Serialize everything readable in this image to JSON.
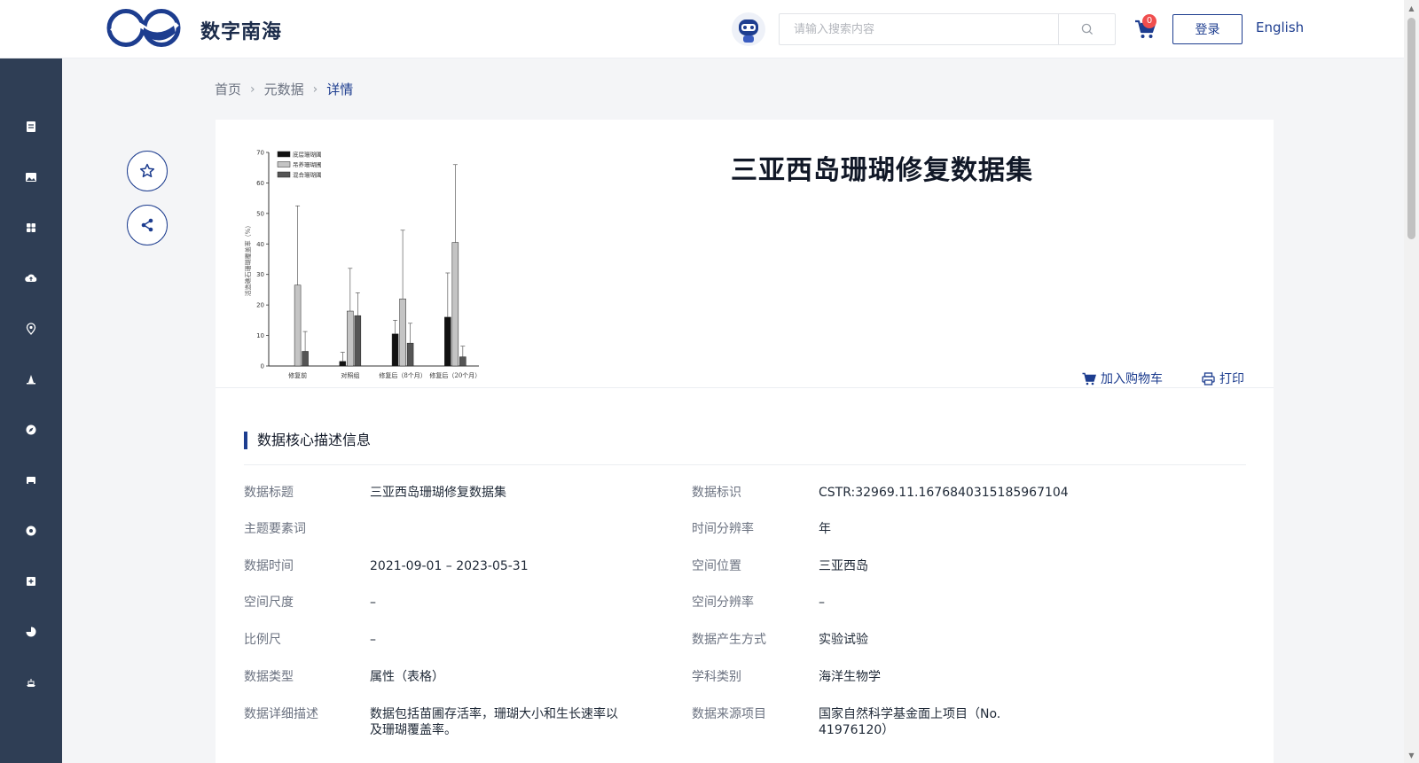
{
  "header": {
    "brand": "数字南海",
    "search_placeholder": "请输入搜索内容",
    "cart_count": "0",
    "login_label": "登录",
    "language_label": "English"
  },
  "sidebar": {
    "icons": [
      "document-icon",
      "image-icon",
      "grid-icon",
      "cloud-upload-icon",
      "location-pin-icon",
      "station-icon",
      "compass-icon",
      "bookmark-card-icon",
      "globe-icon",
      "medical-kit-icon",
      "pie-chart-icon",
      "ship-icon"
    ]
  },
  "breadcrumb": {
    "home": "首页",
    "metadata": "元数据",
    "current": "详情"
  },
  "dataset": {
    "title": "三亚西岛珊瑚修复数据集",
    "add_to_cart": "加入购物车",
    "print": "打印"
  },
  "thumbnail": {
    "chart_data": {
      "type": "bar",
      "ylabel": "活造礁石珊瑚覆盖率（%）",
      "ylim": [
        0,
        70
      ],
      "yticks": [
        0,
        10,
        20,
        30,
        40,
        50,
        60,
        70
      ],
      "categories": [
        "修复前",
        "对照组",
        "修复后（8个月）",
        "修复后（20个月）"
      ],
      "series": [
        {
          "name": "底层珊瑚圃",
          "color": "#111111",
          "values": [
            0,
            1.5,
            10.5,
            16
          ],
          "errors": [
            0,
            3,
            4.5,
            14.5
          ]
        },
        {
          "name": "吊养珊瑚圃",
          "color": "#c4c4c4",
          "values": [
            26.5,
            18,
            22,
            40.5
          ],
          "errors": [
            26,
            14,
            22.5,
            25.5
          ]
        },
        {
          "name": "混合珊瑚圃",
          "color": "#555555",
          "values": [
            4.8,
            16.5,
            7.5,
            3
          ],
          "errors": [
            6.5,
            7.5,
            6.5,
            3.5
          ]
        }
      ]
    }
  },
  "section": {
    "title": "数据核心描述信息"
  },
  "metadata": {
    "left": [
      {
        "label": "数据标题",
        "value": "三亚西岛珊瑚修复数据集"
      },
      {
        "label": "主题要素词",
        "value": ""
      },
      {
        "label": "数据时间",
        "value": "2021-09-01 – 2023-05-31"
      },
      {
        "label": "空间尺度",
        "value": "–"
      },
      {
        "label": "比例尺",
        "value": "–"
      },
      {
        "label": "数据类型",
        "value": "属性（表格）"
      },
      {
        "label": "数据详细描述",
        "value_line1": "数据包括苗圃存活率，珊瑚大小和生长速率以",
        "value_line2": "及珊瑚覆盖率。"
      }
    ],
    "right": [
      {
        "label": "数据标识",
        "value": "CSTR:32969.11.1676840315185967104"
      },
      {
        "label": "时间分辨率",
        "value": "年"
      },
      {
        "label": "空间位置",
        "value": "三亚西岛"
      },
      {
        "label": "空间分辨率",
        "value": "–"
      },
      {
        "label": "数据产生方式",
        "value": "实验试验"
      },
      {
        "label": "学科类别",
        "value": "海洋生物学"
      },
      {
        "label": "数据来源项目",
        "value_line1": "国家自然科学基金面上项目（No.",
        "value_line2": "41976120）"
      }
    ]
  }
}
